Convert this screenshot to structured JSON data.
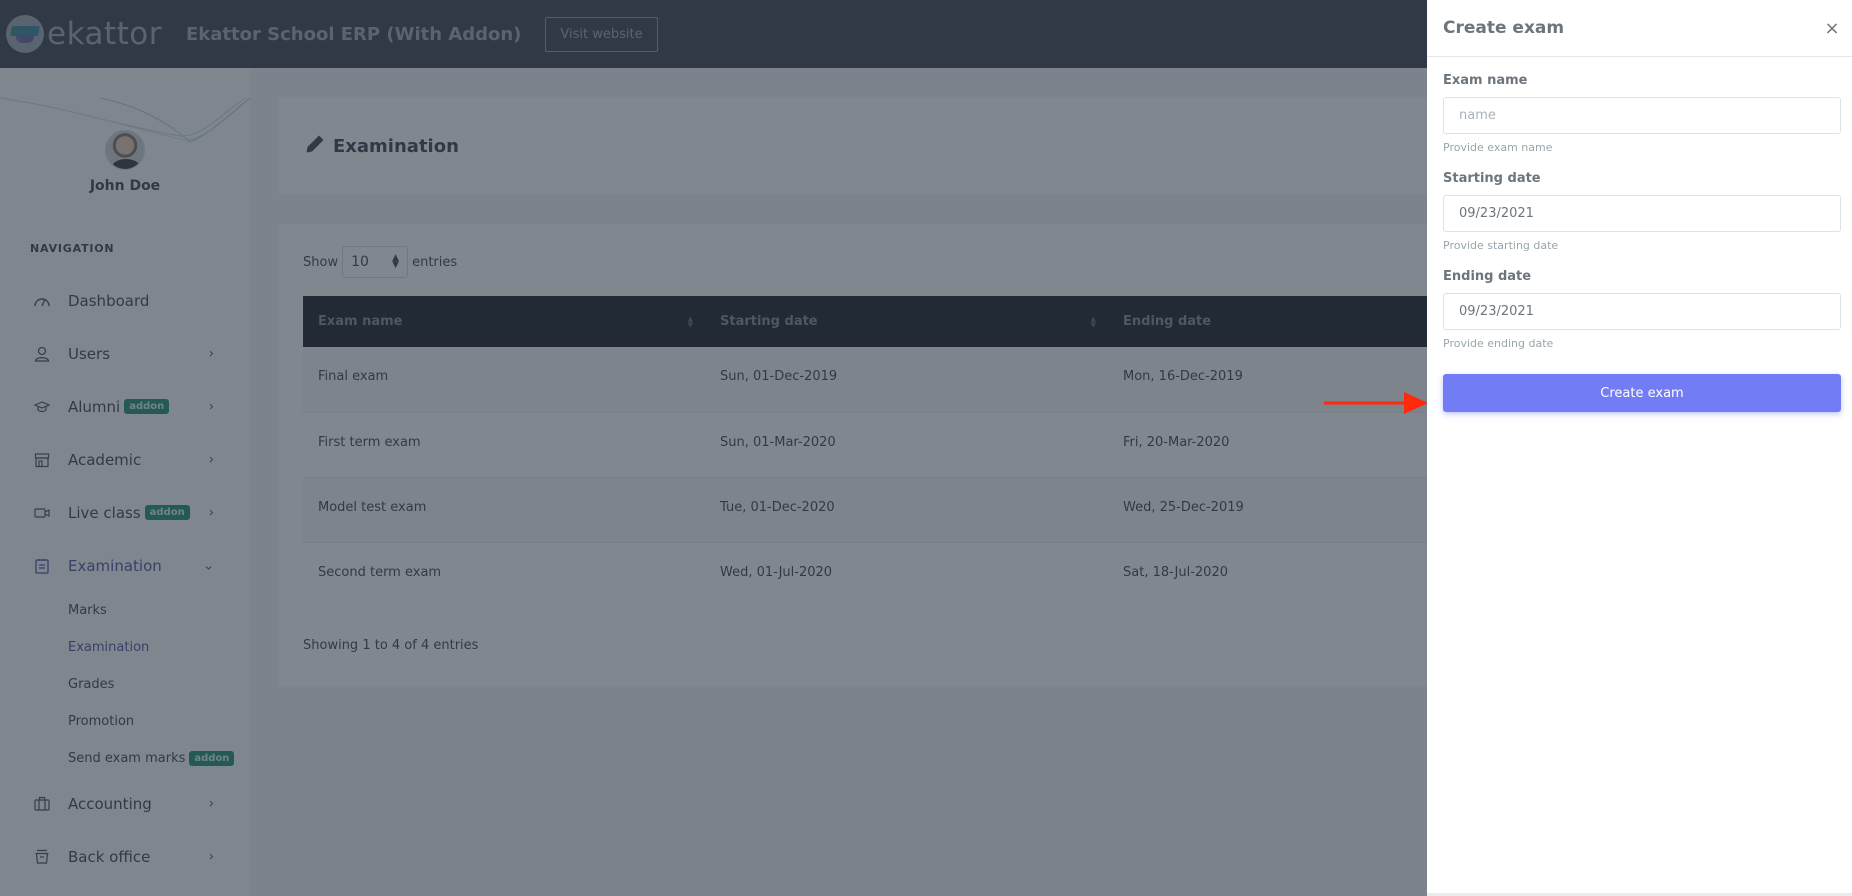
{
  "topbar": {
    "logo_text": "ekattor",
    "app_title": "Ekattor School ERP (With Addon)",
    "visit_website_label": "Visit website"
  },
  "sidebar": {
    "profile_name": "John Doe",
    "nav_title": "NAVIGATION",
    "items": [
      {
        "label": "Dashboard",
        "icon": "speedometer-icon",
        "badge": null,
        "has_chevron": false
      },
      {
        "label": "Users",
        "icon": "user-icon",
        "badge": null,
        "has_chevron": true
      },
      {
        "label": "Alumni",
        "icon": "graduation-cap-icon",
        "badge": "addon",
        "has_chevron": true
      },
      {
        "label": "Academic",
        "icon": "school-icon",
        "badge": null,
        "has_chevron": true
      },
      {
        "label": "Live class",
        "icon": "video-camera-icon",
        "badge": "addon",
        "has_chevron": true
      },
      {
        "label": "Examination",
        "icon": "clipboard-icon",
        "badge": null,
        "has_chevron": true,
        "expanded": true,
        "active": true
      },
      {
        "label": "Accounting",
        "icon": "briefcase-icon",
        "badge": null,
        "has_chevron": true
      },
      {
        "label": "Back office",
        "icon": "inbox-icon",
        "badge": null,
        "has_chevron": true
      }
    ],
    "examination_submenu": [
      {
        "label": "Marks",
        "active": false,
        "badge": null
      },
      {
        "label": "Examination",
        "active": true,
        "badge": null
      },
      {
        "label": "Grades",
        "active": false,
        "badge": null
      },
      {
        "label": "Promotion",
        "active": false,
        "badge": null
      },
      {
        "label": "Send exam marks",
        "active": false,
        "badge": "addon"
      }
    ]
  },
  "main": {
    "page_title": "Examination",
    "show_label": "Show",
    "entries_label": "entries",
    "page_length": "10",
    "table": {
      "columns": [
        "Exam name",
        "Starting date",
        "Ending date"
      ],
      "rows": [
        [
          "Final exam",
          "Sun, 01-Dec-2019",
          "Mon, 16-Dec-2019"
        ],
        [
          "First term exam",
          "Sun, 01-Mar-2020",
          "Fri, 20-Mar-2020"
        ],
        [
          "Model test exam",
          "Tue, 01-Dec-2020",
          "Wed, 25-Dec-2019"
        ],
        [
          "Second term exam",
          "Wed, 01-Jul-2020",
          "Sat, 18-Jul-2020"
        ]
      ]
    },
    "showing_text": "Showing 1 to 4 of 4 entries"
  },
  "panel": {
    "title": "Create exam",
    "close_icon": "×",
    "fields": {
      "exam_name": {
        "label": "Exam name",
        "value": "",
        "placeholder": "name",
        "help": "Provide exam name"
      },
      "starting_date": {
        "label": "Starting date",
        "value": "09/23/2021",
        "placeholder": "",
        "help": "Provide starting date"
      },
      "ending_date": {
        "label": "Ending date",
        "value": "09/23/2021",
        "placeholder": "",
        "help": "Provide ending date"
      }
    },
    "submit_label": "Create exam"
  },
  "colors": {
    "topbar": "#313a46",
    "primary": "#727cf5",
    "addon_badge": "#0acf97",
    "annotation_arrow": "#ff2a0c"
  }
}
